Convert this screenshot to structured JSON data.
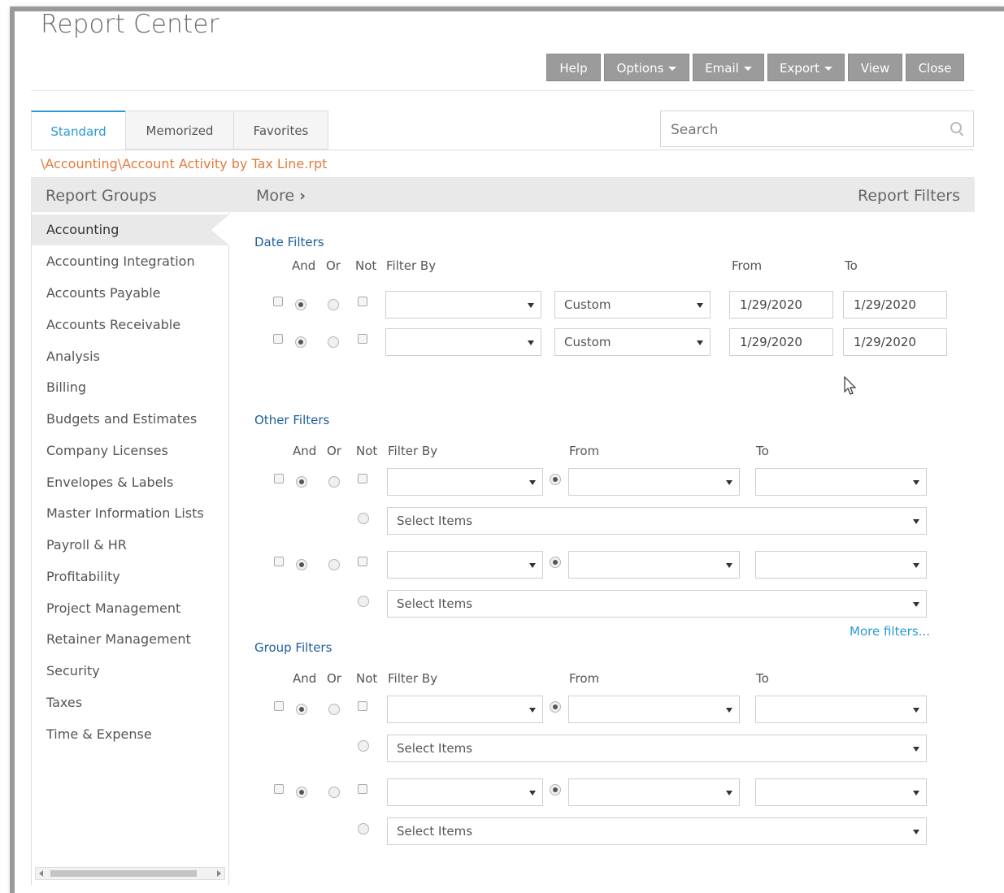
{
  "page": {
    "title": "Report Center"
  },
  "toolbar": {
    "help": "Help",
    "options": "Options",
    "email": "Email",
    "export": "Export",
    "view": "View",
    "close": "Close"
  },
  "tabs": [
    "Standard",
    "Memorized",
    "Favorites"
  ],
  "search": {
    "placeholder": "Search"
  },
  "path": "\\Accounting\\Account Activity by Tax Line.rpt",
  "bar": {
    "left": "Report Groups",
    "more": "More",
    "right": "Report Filters"
  },
  "sidebar": {
    "items": [
      "Accounting",
      "Accounting Integration",
      "Accounts Payable",
      "Accounts Receivable",
      "Analysis",
      "Billing",
      "Budgets and Estimates",
      "Company Licenses",
      "Envelopes & Labels",
      "Master Information Lists",
      "Payroll & HR",
      "Profitability",
      "Project Management",
      "Retainer Management",
      "Security",
      "Taxes",
      "Time & Expense"
    ],
    "active": "Accounting"
  },
  "date_filters": {
    "title": "Date Filters",
    "headers": {
      "and": "And",
      "or": "Or",
      "not": "Not",
      "filter_by": "Filter By",
      "from": "From",
      "to": "To"
    },
    "rows": [
      {
        "filter_by": "",
        "range": "Custom",
        "from": "1/29/2020",
        "to": "1/29/2020"
      },
      {
        "filter_by": "",
        "range": "Custom",
        "from": "1/29/2020",
        "to": "1/29/2020"
      }
    ]
  },
  "other_filters": {
    "title": "Other Filters",
    "headers": {
      "and": "And",
      "or": "Or",
      "not": "Not",
      "filter_by": "Filter By",
      "from": "From",
      "to": "To"
    },
    "select_items": "Select Items",
    "more": "More filters..."
  },
  "group_filters": {
    "title": "Group Filters",
    "headers": {
      "and": "And",
      "or": "Or",
      "not": "Not",
      "filter_by": "Filter By",
      "from": "From",
      "to": "To"
    },
    "select_items": "Select Items"
  }
}
